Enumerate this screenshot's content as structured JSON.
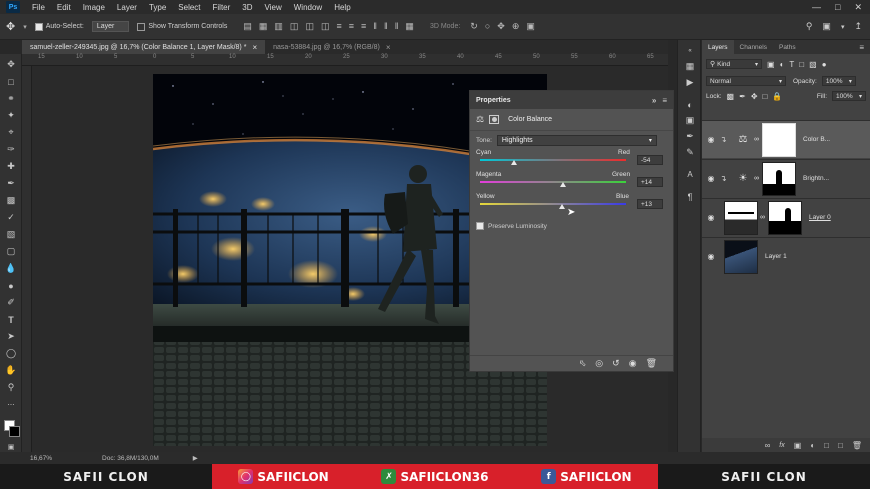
{
  "menubar": {
    "logo": "Ps",
    "items": [
      "File",
      "Edit",
      "Image",
      "Layer",
      "Type",
      "Select",
      "Filter",
      "3D",
      "View",
      "Window",
      "Help"
    ]
  },
  "options": {
    "auto_select_label": "Auto-Select:",
    "auto_select_value": "Layer",
    "transform_label": "Show Transform Controls",
    "mode_3d": "3D Mode:"
  },
  "tabs": [
    {
      "label": "samuel-zeller-249345.jpg @ 16,7% (Color Balance 1, Layer Mask/8) *",
      "active": true
    },
    {
      "label": "nasa-53884.jpg @ 16,7% (RGB/8)",
      "active": false
    }
  ],
  "ruler": [
    "15",
    "10",
    "5",
    "0",
    "5",
    "10",
    "15",
    "20",
    "25",
    "30",
    "35",
    "40",
    "45",
    "50",
    "55",
    "60",
    "65"
  ],
  "properties": {
    "title": "Properties",
    "subtitle": "Color Balance",
    "tone_label": "Tone:",
    "tone_value": "Highlights",
    "sliders": [
      {
        "left": "Cyan",
        "right": "Red",
        "value": "-54",
        "fraction": 0.23
      },
      {
        "left": "Magenta",
        "right": "Green",
        "value": "+14",
        "fraction": 0.57
      },
      {
        "left": "Yellow",
        "right": "Blue",
        "value": "+13",
        "fraction": 0.565
      }
    ],
    "preserve_label": "Preserve Luminosity",
    "preserve_checked": true
  },
  "layers_panel": {
    "tabs": [
      "Layers",
      "Channels",
      "Paths"
    ],
    "kind_label": "Kind",
    "blend_mode": "Normal",
    "opacity_label": "Opacity:",
    "opacity_value": "100%",
    "lock_label": "Lock:",
    "fill_label": "Fill:",
    "fill_value": "100%",
    "layers": [
      {
        "name": "Color B...",
        "selected": true
      },
      {
        "name": "Brightn...",
        "selected": false
      },
      {
        "name": "Layer 0",
        "selected": false
      },
      {
        "name": "Layer 1",
        "selected": false
      }
    ]
  },
  "status": {
    "zoom": "16,67%",
    "doc": "Doc: 36,8M/130,0M"
  },
  "banner": {
    "left": "SAFII CLON",
    "instagram": "SAFIICLON",
    "other": "SAFIICLON36",
    "facebook": "SAFIICLON",
    "right": "SAFII CLON"
  },
  "colors": {
    "accent": "#31a8ff",
    "banner_red": "#d8202a"
  }
}
